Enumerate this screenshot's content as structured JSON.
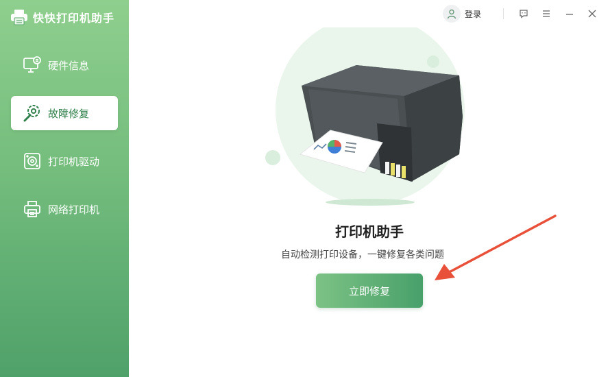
{
  "app": {
    "name": "快快打印机助手"
  },
  "sidebar": {
    "items": [
      {
        "label": "硬件信息",
        "icon": "monitor-info-icon",
        "active": false
      },
      {
        "label": "故障修复",
        "icon": "wrench-gear-icon",
        "active": true
      },
      {
        "label": "打印机驱动",
        "icon": "disk-driver-icon",
        "active": false
      },
      {
        "label": "网络打印机",
        "icon": "printer-icon",
        "active": false
      }
    ]
  },
  "topbar": {
    "login_label": "登录",
    "icons": [
      "feedback-icon",
      "menu-icon",
      "minimize-icon",
      "close-icon"
    ]
  },
  "main": {
    "title": "打印机助手",
    "subtitle": "自动检测打印设备，一键修复各类问题",
    "cta_label": "立即修复"
  },
  "colors": {
    "sidebar_top": "#8fcf8e",
    "sidebar_bottom": "#4fa16a",
    "active_text": "#2f7f4a",
    "cta_start": "#7cc285",
    "cta_end": "#48a06a",
    "arrow": "#e8503a"
  }
}
